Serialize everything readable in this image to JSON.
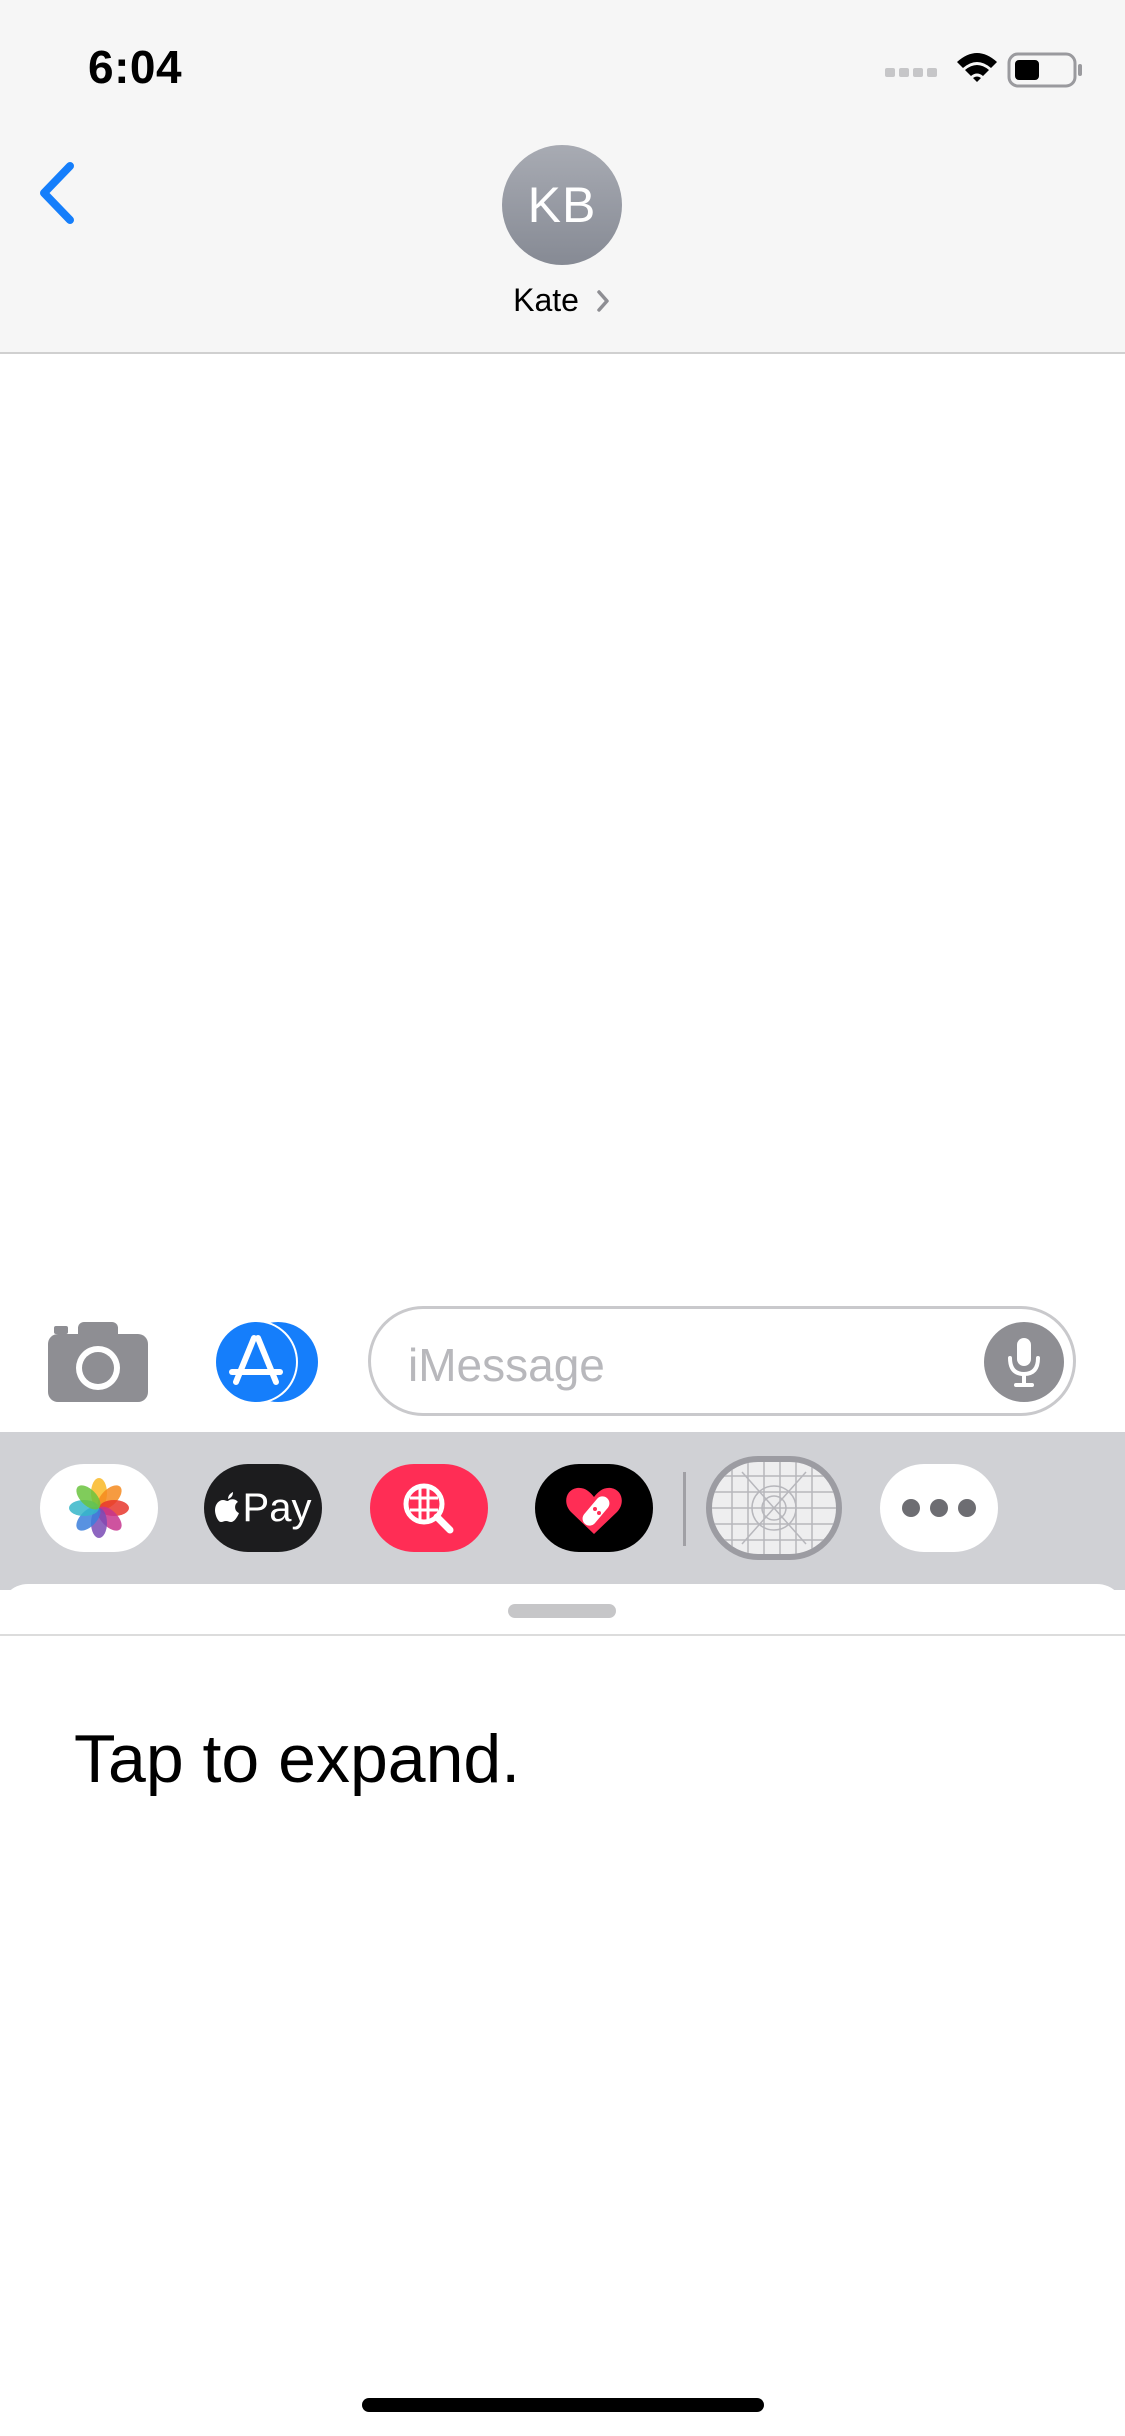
{
  "status_bar": {
    "time": "6:04"
  },
  "header": {
    "avatar_initials": "KB",
    "contact_name": "Kate"
  },
  "compose": {
    "placeholder": "iMessage"
  },
  "app_drawer": {
    "apple_pay_label": "Pay"
  },
  "panel": {
    "message": "Tap to expand."
  },
  "colors": {
    "accent": "#157efb",
    "search_app": "#ff2d55"
  }
}
